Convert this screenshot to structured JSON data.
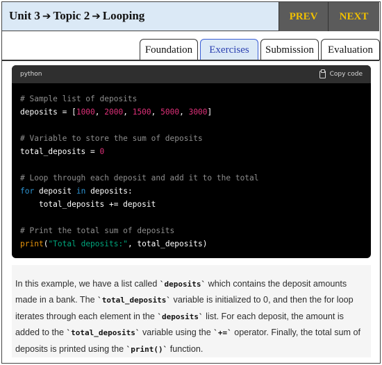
{
  "header": {
    "breadcrumb": [
      "Unit 3",
      "Topic 2",
      "Looping"
    ],
    "arrow": "➔",
    "prev_label": "PREV",
    "next_label": "NEXT"
  },
  "tabs": [
    {
      "label": "Foundation",
      "active": false
    },
    {
      "label": "Exercises",
      "active": true
    },
    {
      "label": "Submission",
      "active": false
    },
    {
      "label": "Evaluation",
      "active": false
    }
  ],
  "code": {
    "language": "python",
    "copy_label": "Copy code",
    "lines": [
      [
        {
          "t": "# Sample list of deposits",
          "c": "com"
        }
      ],
      [
        {
          "t": "deposits = [",
          "c": "txt"
        },
        {
          "t": "1000",
          "c": "num"
        },
        {
          "t": ", ",
          "c": "txt"
        },
        {
          "t": "2000",
          "c": "num"
        },
        {
          "t": ", ",
          "c": "txt"
        },
        {
          "t": "1500",
          "c": "num"
        },
        {
          "t": ", ",
          "c": "txt"
        },
        {
          "t": "5000",
          "c": "num"
        },
        {
          "t": ", ",
          "c": "txt"
        },
        {
          "t": "3000",
          "c": "num"
        },
        {
          "t": "]",
          "c": "txt"
        }
      ],
      [],
      [
        {
          "t": "# Variable to store the sum of deposits",
          "c": "com"
        }
      ],
      [
        {
          "t": "total_deposits = ",
          "c": "txt"
        },
        {
          "t": "0",
          "c": "num"
        }
      ],
      [],
      [
        {
          "t": "# Loop through each deposit and add it to the total",
          "c": "com"
        }
      ],
      [
        {
          "t": "for",
          "c": "kw"
        },
        {
          "t": " deposit ",
          "c": "txt"
        },
        {
          "t": "in",
          "c": "kw"
        },
        {
          "t": " deposits:",
          "c": "txt"
        }
      ],
      [
        {
          "t": "    total_deposits += deposit",
          "c": "txt"
        }
      ],
      [],
      [
        {
          "t": "# Print the total sum of deposits",
          "c": "com"
        }
      ],
      [
        {
          "t": "print",
          "c": "fn"
        },
        {
          "t": "(",
          "c": "txt"
        },
        {
          "t": "\"Total deposits:\"",
          "c": "str"
        },
        {
          "t": ", total_deposits)",
          "c": "txt"
        }
      ]
    ]
  },
  "explanation": [
    {
      "t": "In this example, we have a list called "
    },
    {
      "t": "`deposits`",
      "code": true
    },
    {
      "t": " which contains the deposit amounts made in a bank. The "
    },
    {
      "t": "`total_deposits`",
      "code": true
    },
    {
      "t": " variable is initialized to 0, and then the for loop iterates through each element in the "
    },
    {
      "t": "`deposits`",
      "code": true
    },
    {
      "t": " list. For each deposit, the amount is added to the "
    },
    {
      "t": "`total_deposits`",
      "code": true
    },
    {
      "t": " variable using the "
    },
    {
      "t": "`+=`",
      "code": true
    },
    {
      "t": " operator. Finally, the total sum of deposits is printed using the "
    },
    {
      "t": "`print()`",
      "code": true
    },
    {
      "t": " function."
    }
  ],
  "colors": {
    "header_bg": "#dbe9f6",
    "nav_bg": "#5b5b5b",
    "nav_text": "#f0c000",
    "active_tab_border": "#3a5fd6"
  }
}
